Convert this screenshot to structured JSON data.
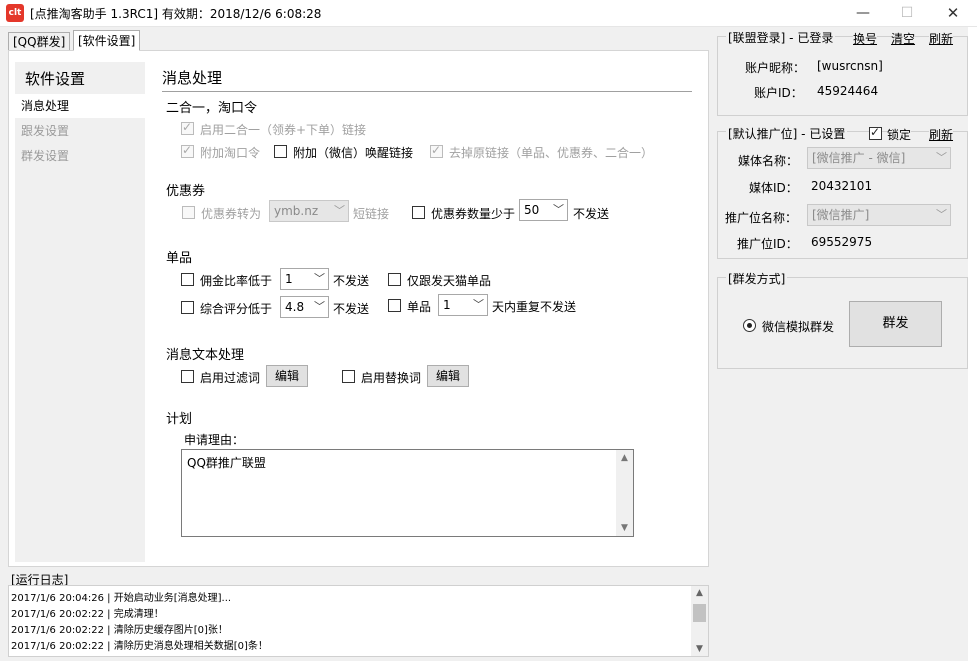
{
  "window": {
    "icon_text": "clt",
    "title": "[点推淘客助手 1.3RC1] 有效期：2018/12/6 6:08:28",
    "min": "—",
    "max": "☐",
    "close": "✕"
  },
  "tabs": [
    "[QQ群发]",
    "[软件设置]"
  ],
  "sidebar": {
    "title": "软件设置",
    "items": [
      "消息处理",
      "跟发设置",
      "群发设置"
    ]
  },
  "main": {
    "section_title": "消息处理",
    "merge": {
      "title": "二合一，淘口令",
      "enable_label": "启用二合一（领券+下单）链接",
      "attach_label": "附加淘口令",
      "wechat_label": "附加（微信）唤醒链接",
      "remove_label": "去掉原链接（单品、优惠券、二合一）"
    },
    "coupon": {
      "title": "优惠券",
      "convert_label": "优惠券转为",
      "domain_value": "ymb.nz",
      "short_link_label": "短链接",
      "count_label": "优惠券数量少于",
      "count_value": "50",
      "not_send_label": "不发送"
    },
    "item": {
      "title": "单品",
      "commission_label": "佣金比率低于",
      "commission_value": "1",
      "commission_suffix": "不发送",
      "tmall_label": "仅跟发天猫单品",
      "rating_label": "综合评分低于",
      "rating_value": "4.8",
      "rating_suffix": "不发送",
      "single_label": "单品",
      "days_value": "1",
      "days_suffix": "天内重复不发送"
    },
    "text_processing": {
      "title": "消息文本处理",
      "filter_label": "启用过滤词",
      "filter_button": "编辑",
      "replace_label": "启用替换词",
      "replace_button": "编辑"
    },
    "plan": {
      "title": "计划",
      "reason_label": "申请理由：",
      "reason_value": "QQ群推广联盟"
    }
  },
  "alliance": {
    "title": "[联盟登录] - 已登录",
    "switch_label": "换号",
    "clear_label": "清空",
    "refresh_label": "刷新",
    "nickname_label": "账户昵称：",
    "nickname_value": "[wusrcnsn]",
    "id_label": "账户ID：",
    "id_value": "45924464"
  },
  "promo": {
    "title": "[默认推广位] - 已设置",
    "lock_label": "锁定",
    "refresh_label": "刷新",
    "media_name_label": "媒体名称：",
    "media_name_value": "[微信推广 - 微信]",
    "media_id_label": "媒体ID：",
    "media_id_value": "20432101",
    "position_name_label": "推广位名称：",
    "position_name_value": "[微信推广]",
    "position_id_label": "推广位ID：",
    "position_id_value": "69552975"
  },
  "broadcast": {
    "title": "[群发方式]",
    "radio_label": "微信模拟群发",
    "button_label": "群发"
  },
  "log": {
    "title": "[运行日志]",
    "lines": [
      "2017/1/6 20:04:26 | 开始启动业务[消息处理]...",
      "2017/1/6 20:02:22 | 完成清理！",
      "2017/1/6 20:02:22 | 清除历史缓存图片[0]张！",
      "2017/1/6 20:02:22 | 清除历史消息处理相关数据[0]条！"
    ]
  }
}
